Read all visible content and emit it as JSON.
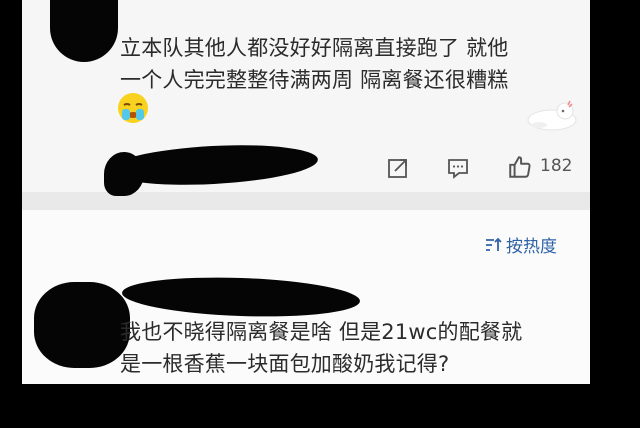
{
  "first_comment": {
    "lines": [
      "立本队其他人都没好好隔离直接跑了 就他",
      "一个人完完整整待满两周 隔离餐还很糟糕"
    ],
    "emoji": "crying-emoji",
    "sticker": "reclining-blob-sticker"
  },
  "actions": {
    "share_icon": "share-icon",
    "comment_icon": "comment-icon",
    "like_icon": "thumbs-up-icon",
    "like_count": "182"
  },
  "sort_control": {
    "icon": "sort-icon",
    "label": "按热度"
  },
  "second_comment": {
    "lines": [
      "我也不晓得隔离餐是啥 但是21wc的配餐就",
      "是一根香蕉一块面包加酸奶我记得?"
    ]
  },
  "colors": {
    "background": "#000000",
    "card": "#f6f6f6",
    "separator": "#e9e9e9",
    "link": "#2f63a6",
    "text": "#2b2b2b"
  }
}
